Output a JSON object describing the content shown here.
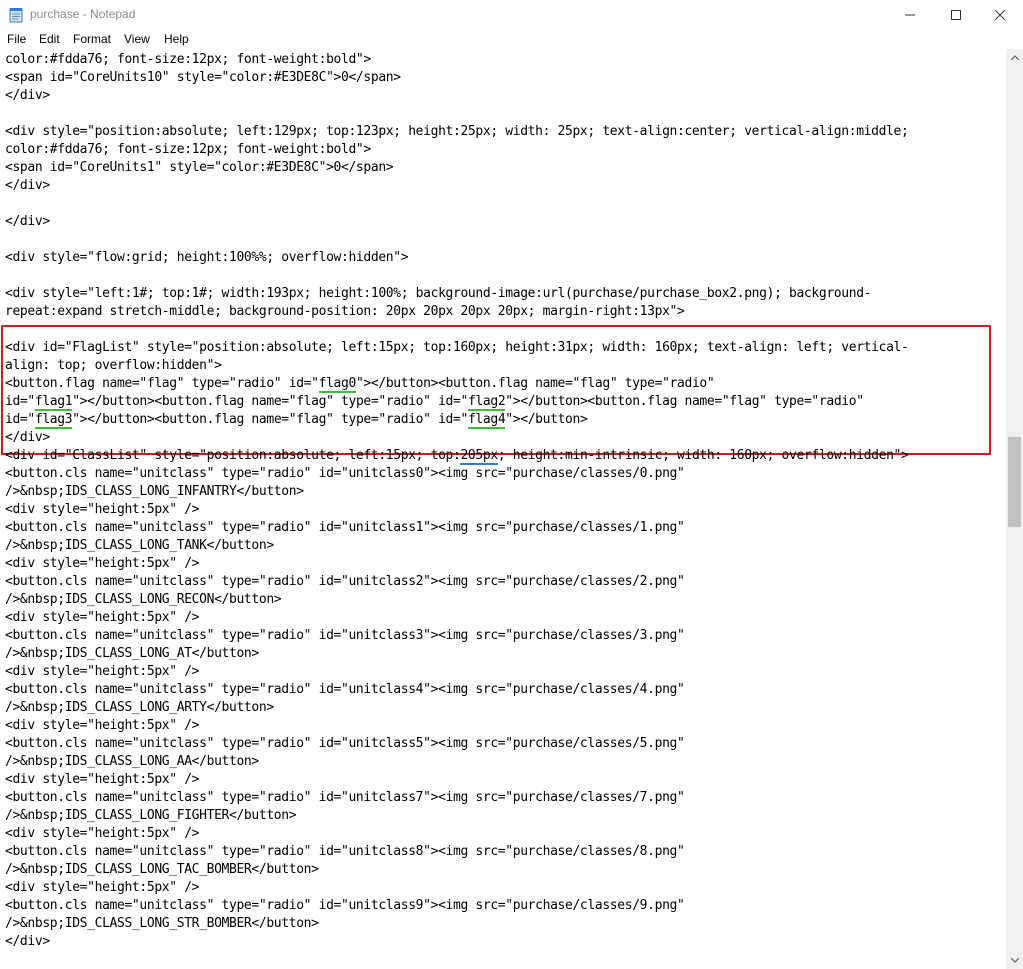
{
  "window": {
    "title": "purchase - Notepad",
    "controls": {
      "minimize": "—",
      "maximize": "☐",
      "close": "✕"
    }
  },
  "menu": [
    "File",
    "Edit",
    "Format",
    "View",
    "Help"
  ],
  "editor": {
    "lines": [
      "color:#fdda76; font-size:12px; font-weight:bold\">",
      "<span id=\"CoreUnits10\" style=\"color:#E3DE8C\">0</span>",
      "</div>",
      "",
      "<div style=\"position:absolute; left:129px; top:123px; height:25px; width: 25px; text-align:center; vertical-align:middle;",
      "color:#fdda76; font-size:12px; font-weight:bold\">",
      "<span id=\"CoreUnits1\" style=\"color:#E3DE8C\">0</span>",
      "</div>",
      "",
      "</div>",
      "",
      "<div style=\"flow:grid; height:100%%; overflow:hidden\">",
      "",
      "<div style=\"left:1#; top:1#; width:193px; height:100%; background-image:url(purchase/purchase_box2.png); background-",
      "repeat:expand stretch-middle; background-position: 20px 20px 20px 20px; margin-right:13px\">",
      "",
      "<div id=\"FlagList\" style=\"position:absolute; left:15px; top:160px; height:31px; width: 160px; text-align: left; vertical-",
      "align: top; overflow:hidden\">",
      "<button.flag name=\"flag\" type=\"radio\" id=\"flag0\"></button><button.flag name=\"flag\" type=\"radio\"",
      "id=\"flag1\"></button><button.flag name=\"flag\" type=\"radio\" id=\"flag2\"></button><button.flag name=\"flag\" type=\"radio\"",
      "id=\"flag3\"></button><button.flag name=\"flag\" type=\"radio\" id=\"flag4\"></button>",
      "</div>",
      "<div id=\"ClassList\" style=\"position:absolute; left:15px; top:205px; height:min-intrinsic; width: 160px; overflow:hidden\">",
      "<button.cls name=\"unitclass\" type=\"radio\" id=\"unitclass0\"><img src=\"purchase/classes/0.png\"",
      "/>&nbsp;IDS_CLASS_LONG_INFANTRY</button>",
      "<div style=\"height:5px\" />",
      "<button.cls name=\"unitclass\" type=\"radio\" id=\"unitclass1\"><img src=\"purchase/classes/1.png\"",
      "/>&nbsp;IDS_CLASS_LONG_TANK</button>",
      "<div style=\"height:5px\" />",
      "<button.cls name=\"unitclass\" type=\"radio\" id=\"unitclass2\"><img src=\"purchase/classes/2.png\"",
      "/>&nbsp;IDS_CLASS_LONG_RECON</button>",
      "<div style=\"height:5px\" />",
      "<button.cls name=\"unitclass\" type=\"radio\" id=\"unitclass3\"><img src=\"purchase/classes/3.png\"",
      "/>&nbsp;IDS_CLASS_LONG_AT</button>",
      "<div style=\"height:5px\" />",
      "<button.cls name=\"unitclass\" type=\"radio\" id=\"unitclass4\"><img src=\"purchase/classes/4.png\"",
      "/>&nbsp;IDS_CLASS_LONG_ARTY</button>",
      "<div style=\"height:5px\" />",
      "<button.cls name=\"unitclass\" type=\"radio\" id=\"unitclass5\"><img src=\"purchase/classes/5.png\"",
      "/>&nbsp;IDS_CLASS_LONG_AA</button>",
      "<div style=\"height:5px\" />",
      "<button.cls name=\"unitclass\" type=\"radio\" id=\"unitclass7\"><img src=\"purchase/classes/7.png\"",
      "/>&nbsp;IDS_CLASS_LONG_FIGHTER</button>",
      "<div style=\"height:5px\" />",
      "<button.cls name=\"unitclass\" type=\"radio\" id=\"unitclass8\"><img src=\"purchase/classes/8.png\"",
      "/>&nbsp;IDS_CLASS_LONG_TAC_BOMBER</button>",
      "<div style=\"height:5px\" />",
      "<button.cls name=\"unitclass\" type=\"radio\" id=\"unitclass9\"><img src=\"purchase/classes/9.png\"",
      "/>&nbsp;IDS_CLASS_LONG_STR_BOMBER</button>",
      "</div>"
    ],
    "underlines": [
      {
        "line": 18,
        "text": "flag0",
        "color": "#3bbf3b"
      },
      {
        "line": 19,
        "text": "flag1",
        "color": "#3bbf3b"
      },
      {
        "line": 19,
        "text": "flag2",
        "color": "#3bbf3b"
      },
      {
        "line": 20,
        "text": "flag3",
        "color": "#3bbf3b"
      },
      {
        "line": 20,
        "text": "flag4",
        "color": "#3bbf3b"
      },
      {
        "line": 22,
        "text": "205px",
        "color": "#2f7fd6"
      }
    ],
    "highlight_color": "#d11a1a"
  }
}
